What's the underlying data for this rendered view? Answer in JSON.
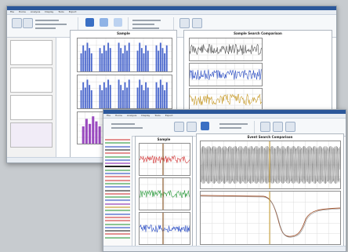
{
  "window1": {
    "menu_tabs": [
      "File",
      "Home",
      "Analysis",
      "Display",
      "Tools",
      "Export"
    ],
    "main_panel_title": "Sample",
    "right_panel_title": "Sample Search Comparison"
  },
  "window2": {
    "menu_tabs": [
      "File",
      "Home",
      "Analysis",
      "Display",
      "Tools",
      "Export"
    ],
    "main_panel_title": "Sample",
    "right_panel_title": "Event Search Comparison"
  },
  "colors": {
    "ribbon_blue": "#3a6fc4",
    "trace_red": "#d23a3a",
    "trace_green": "#2f9a3f",
    "trace_blue": "#2d4fc4",
    "trace_purple": "#8a2bb5",
    "trace_gold": "#c79b2b"
  },
  "icons": [
    "cursor-icon",
    "zoom-icon",
    "measure-icon",
    "filter-icon",
    "export-icon"
  ]
}
